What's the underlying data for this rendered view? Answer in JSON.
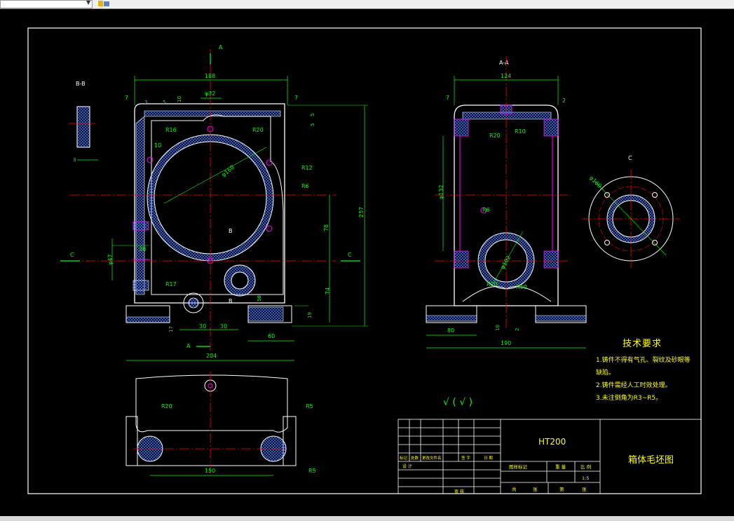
{
  "section_labels": {
    "bb": "B-B",
    "aa": "A-A",
    "c_view": "C",
    "a_top": "A",
    "a_bottom": "A",
    "c_left": "C",
    "c_right": "C",
    "b_upper": "B",
    "b_lower": "B"
  },
  "dimensions_front": {
    "width_188": "188",
    "dia_32": "φ32",
    "d7a": "7",
    "d7b": "7",
    "d10": "10",
    "d5a": "5",
    "d5b": "5",
    "r16": "R16",
    "r20": "R20",
    "r12": "R12",
    "r6": "R6",
    "d10b": "10",
    "dia160": "φ160",
    "d78": "78",
    "d257": "257",
    "dia47": "φ47",
    "d36": "36",
    "r17": "R17",
    "d58": "58",
    "d74": "74",
    "d19": "19",
    "d17": "17",
    "d30a": "30",
    "d30b": "30",
    "d60": "60",
    "d204": "204",
    "d3": "3",
    "d5c": "5"
  },
  "dimensions_side": {
    "width_124": "124",
    "d7": "7",
    "d2": "2",
    "r20": "R20",
    "r10": "R10",
    "dia132": "φ132",
    "r6": "R6",
    "dia102": "φ102",
    "r20b": "R20",
    "r10b": "R10",
    "d80": "80",
    "d10": "10",
    "d2b": "2",
    "d190": "190"
  },
  "dimensions_c_view": {
    "dia160": "φ160"
  },
  "dimensions_bottom": {
    "r20": "R20",
    "r5a": "R5",
    "r5b": "R5",
    "d150": "150"
  },
  "tech_requirements": {
    "heading": "技术要求",
    "items": [
      "1.铸件不得有气孔、裂纹及砂眼等",
      "缺陷。",
      "2.铸件需经人工时效处理。",
      "3.未注倒角为R3~R5。"
    ]
  },
  "roughness_symbol": "√ ( √ )",
  "title_block": {
    "material": "HT200",
    "drawing_name": "箱体毛坯图",
    "revision_labels": [
      "标记",
      "处数",
      "更改文件名",
      "签 字",
      "日 期"
    ],
    "design_label": "设 计",
    "review_label": "审 核",
    "stage_label": "图样标记",
    "weight_label": "重 量",
    "scale_label": "比 例",
    "scale_value": "1:5",
    "sheet_total_label": "共",
    "sheet_total_unit": "张",
    "sheet_label": "第",
    "sheet_unit": "张"
  },
  "colors": {
    "background": "#000000",
    "outline": "#ffffff",
    "dimension": "#00ff00",
    "centerline": "#ff0000",
    "hatch": "#4d7dff",
    "hole": "#ff00ff",
    "text_yellow": "#ffff00"
  }
}
